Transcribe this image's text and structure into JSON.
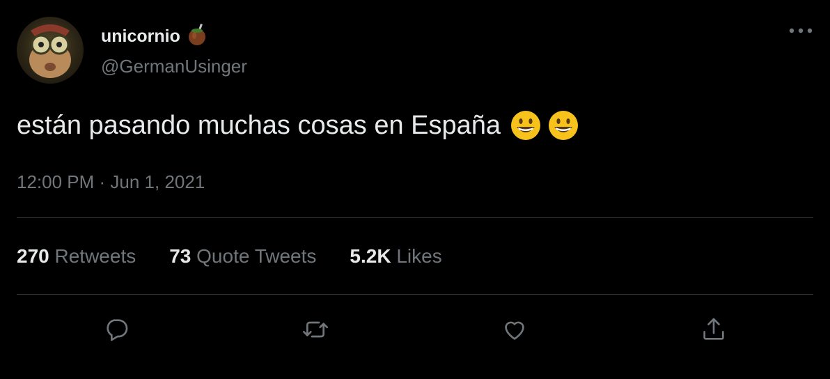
{
  "user": {
    "display_name": "unicornio",
    "handle": "@GermanUsinger",
    "avatar_icon": "avatar-cartoon-character",
    "name_emoji_icon": "mate-gourd-icon"
  },
  "tweet": {
    "text": "están pasando muchas cosas en España",
    "emojis": [
      "grinning-face-icon",
      "grinning-face-icon"
    ],
    "timestamp": "12:00 PM · Jun 1, 2021"
  },
  "stats": [
    {
      "count": "270",
      "label": "Retweets"
    },
    {
      "count": "73",
      "label": "Quote Tweets"
    },
    {
      "count": "5.2K",
      "label": "Likes"
    }
  ],
  "actions": [
    "reply-icon",
    "retweet-icon",
    "like-icon",
    "share-icon"
  ],
  "colors": {
    "background": "#000000",
    "primary_text": "#e7e9ea",
    "secondary_text": "#71767b",
    "divider": "#2f3336"
  }
}
